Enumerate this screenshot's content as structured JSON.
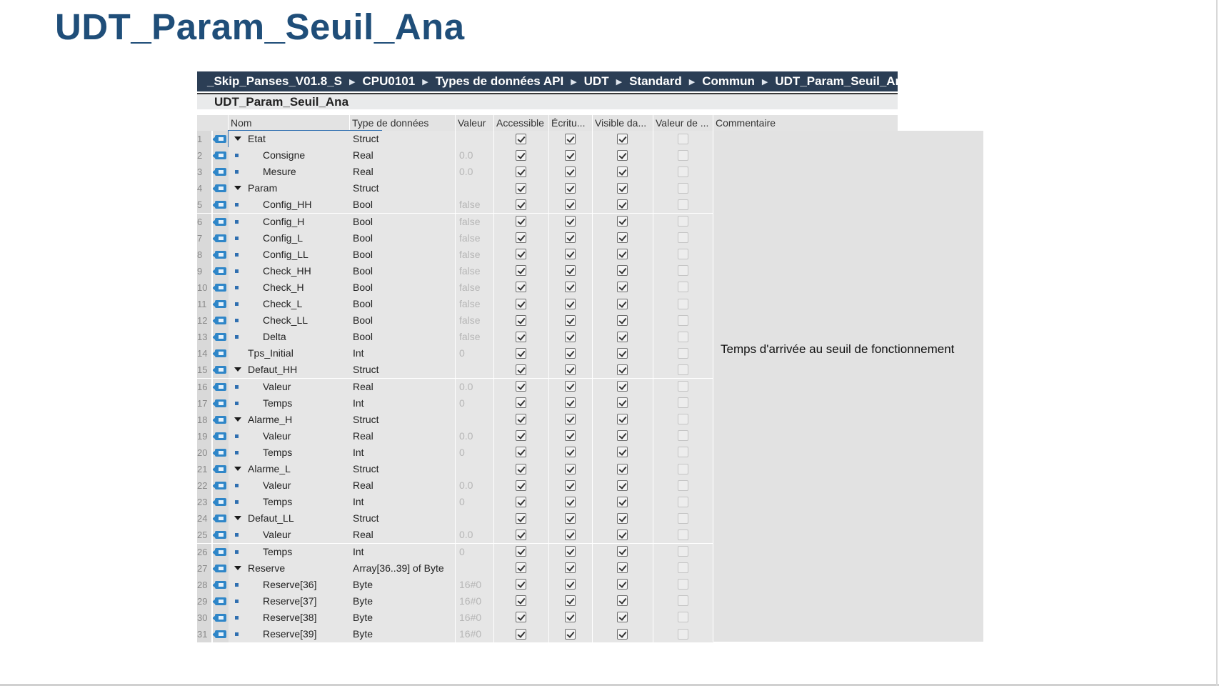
{
  "slide": {
    "title": "UDT_Param_Seuil_Ana"
  },
  "breadcrumb": [
    "_Skip_Panses_V01.8_S",
    "CPU0101",
    "Types de données API",
    "UDT",
    "Standard",
    "Commun",
    "UDT_Param_Seuil_Ana"
  ],
  "editor": {
    "title": "UDT_Param_Seuil_Ana"
  },
  "columns": {
    "name": "Nom",
    "type": "Type de données",
    "value": "Valeur",
    "accessible": "Accessible",
    "write": "Écritu...",
    "visible": "Visible da...",
    "default": "Valeur de ...",
    "comment": "Commentaire"
  },
  "rows": [
    {
      "num": "1",
      "level": 0,
      "expand": true,
      "name": "Etat",
      "type": "Struct",
      "value": ""
    },
    {
      "num": "2",
      "level": 1,
      "expand": false,
      "name": "Consigne",
      "type": "Real",
      "value": "0.0"
    },
    {
      "num": "3",
      "level": 1,
      "expand": false,
      "name": "Mesure",
      "type": "Real",
      "value": "0.0"
    },
    {
      "num": "4",
      "level": 0,
      "expand": true,
      "name": "Param",
      "type": "Struct",
      "value": ""
    },
    {
      "num": "5",
      "level": 1,
      "expand": false,
      "name": "Config_HH",
      "type": "Bool",
      "value": "false"
    },
    {
      "num": "6",
      "level": 1,
      "expand": false,
      "name": "Config_H",
      "type": "Bool",
      "value": "false"
    },
    {
      "num": "7",
      "level": 1,
      "expand": false,
      "name": "Config_L",
      "type": "Bool",
      "value": "false"
    },
    {
      "num": "8",
      "level": 1,
      "expand": false,
      "name": "Config_LL",
      "type": "Bool",
      "value": "false"
    },
    {
      "num": "9",
      "level": 1,
      "expand": false,
      "name": "Check_HH",
      "type": "Bool",
      "value": "false"
    },
    {
      "num": "10",
      "level": 1,
      "expand": false,
      "name": "Check_H",
      "type": "Bool",
      "value": "false"
    },
    {
      "num": "11",
      "level": 1,
      "expand": false,
      "name": "Check_L",
      "type": "Bool",
      "value": "false"
    },
    {
      "num": "12",
      "level": 1,
      "expand": false,
      "name": "Check_LL",
      "type": "Bool",
      "value": "false"
    },
    {
      "num": "13",
      "level": 1,
      "expand": false,
      "name": "Delta",
      "type": "Bool",
      "value": "false"
    },
    {
      "num": "14",
      "level": 0,
      "expand": false,
      "leaf": true,
      "name": "Tps_Initial",
      "type": "Int",
      "value": "0"
    },
    {
      "num": "15",
      "level": 0,
      "expand": true,
      "name": "Defaut_HH",
      "type": "Struct",
      "value": ""
    },
    {
      "num": "16",
      "level": 1,
      "expand": false,
      "name": "Valeur",
      "type": "Real",
      "value": "0.0"
    },
    {
      "num": "17",
      "level": 1,
      "expand": false,
      "name": "Temps",
      "type": "Int",
      "value": "0"
    },
    {
      "num": "18",
      "level": 0,
      "expand": true,
      "name": "Alarme_H",
      "type": "Struct",
      "value": ""
    },
    {
      "num": "19",
      "level": 1,
      "expand": false,
      "name": "Valeur",
      "type": "Real",
      "value": "0.0"
    },
    {
      "num": "20",
      "level": 1,
      "expand": false,
      "name": "Temps",
      "type": "Int",
      "value": "0"
    },
    {
      "num": "21",
      "level": 0,
      "expand": true,
      "name": "Alarme_L",
      "type": "Struct",
      "value": ""
    },
    {
      "num": "22",
      "level": 1,
      "expand": false,
      "name": "Valeur",
      "type": "Real",
      "value": "0.0"
    },
    {
      "num": "23",
      "level": 1,
      "expand": false,
      "name": "Temps",
      "type": "Int",
      "value": "0"
    },
    {
      "num": "24",
      "level": 0,
      "expand": true,
      "name": "Defaut_LL",
      "type": "Struct",
      "value": ""
    },
    {
      "num": "25",
      "level": 1,
      "expand": false,
      "name": "Valeur",
      "type": "Real",
      "value": "0.0"
    },
    {
      "num": "26",
      "level": 1,
      "expand": false,
      "name": "Temps",
      "type": "Int",
      "value": "0"
    },
    {
      "num": "27",
      "level": 0,
      "expand": true,
      "name": "Reserve",
      "type": "Array[36..39] of Byte",
      "value": ""
    },
    {
      "num": "28",
      "level": 1,
      "expand": false,
      "name": "Reserve[36]",
      "type": "Byte",
      "value": "16#0"
    },
    {
      "num": "29",
      "level": 1,
      "expand": false,
      "name": "Reserve[37]",
      "type": "Byte",
      "value": "16#0"
    },
    {
      "num": "30",
      "level": 1,
      "expand": false,
      "name": "Reserve[38]",
      "type": "Byte",
      "value": "16#0"
    },
    {
      "num": "31",
      "level": 1,
      "expand": false,
      "name": "Reserve[39]",
      "type": "Byte",
      "value": "16#0"
    }
  ],
  "checks": {
    "accessible": true,
    "write": true,
    "visible": true,
    "default": false
  },
  "comment": {
    "row": "14",
    "text": "Temps d'arrivée au seuil de fonctionnement"
  }
}
